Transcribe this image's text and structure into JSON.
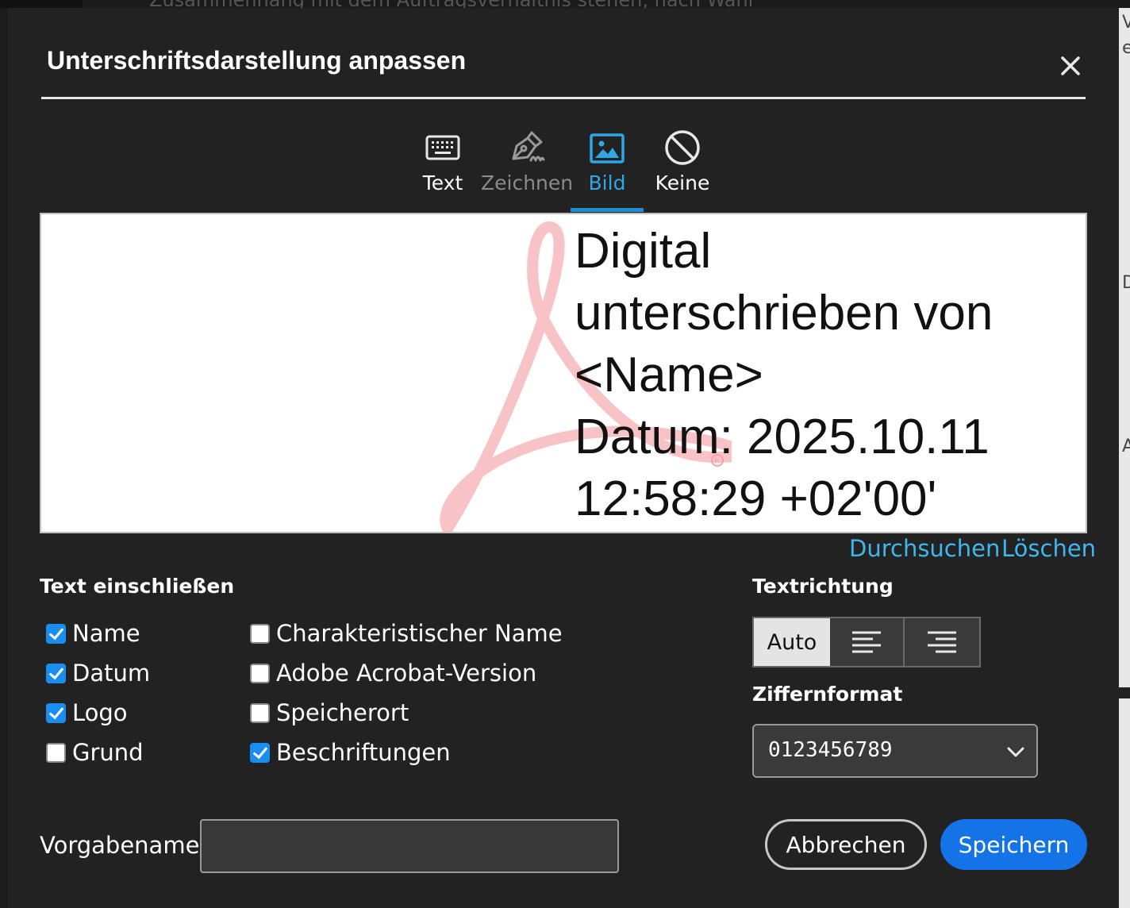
{
  "background": {
    "top_text": "Zusammenhang mit dem Auftragsverhältnis stehen, nach Wahl",
    "right_glyphs": [
      "V",
      "e",
      "D",
      "A"
    ]
  },
  "dialog": {
    "title": "Unterschriftsdarstellung anpassen",
    "close_icon": "close-icon"
  },
  "tabs": [
    {
      "label": "Text",
      "icon": "keyboard-icon",
      "state": "normal"
    },
    {
      "label": "Zeichnen",
      "icon": "pen-icon",
      "state": "disabled"
    },
    {
      "label": "Bild",
      "icon": "image-icon",
      "state": "selected"
    },
    {
      "label": "Keine",
      "icon": "none-icon",
      "state": "normal"
    }
  ],
  "preview": {
    "lines": [
      "Digital",
      "unterschrieben von",
      "<Name>",
      "Datum: 2025.10.11",
      "12:58:29 +02'00'"
    ],
    "logo": "acrobat-logo"
  },
  "image_actions": {
    "browse": "Durchsuchen",
    "delete": "Löschen"
  },
  "include_text": {
    "heading": "Text einschließen",
    "options": [
      {
        "label": "Name",
        "checked": true
      },
      {
        "label": "Datum",
        "checked": true
      },
      {
        "label": "Logo",
        "checked": true
      },
      {
        "label": "Grund",
        "checked": false
      },
      {
        "label": "Charakteristischer Name",
        "checked": false
      },
      {
        "label": "Adobe Acrobat-Version",
        "checked": false
      },
      {
        "label": "Speicherort",
        "checked": false
      },
      {
        "label": "Beschriftungen",
        "checked": true
      }
    ]
  },
  "text_direction": {
    "heading": "Textrichtung",
    "options": [
      "Auto",
      "align-left-icon",
      "align-right-icon"
    ],
    "selected": "Auto"
  },
  "digit_format": {
    "heading": "Ziffernformat",
    "value": "0123456789"
  },
  "preset": {
    "label": "Vorgabename",
    "value": ""
  },
  "buttons": {
    "cancel": "Abbrechen",
    "save": "Speichern"
  },
  "colors": {
    "accent": "#1473e6",
    "link": "#3fb7ee",
    "tab_selected": "#1e8fd6",
    "checkbox": "#1a8ef0",
    "dialog_bg": "#222222"
  }
}
